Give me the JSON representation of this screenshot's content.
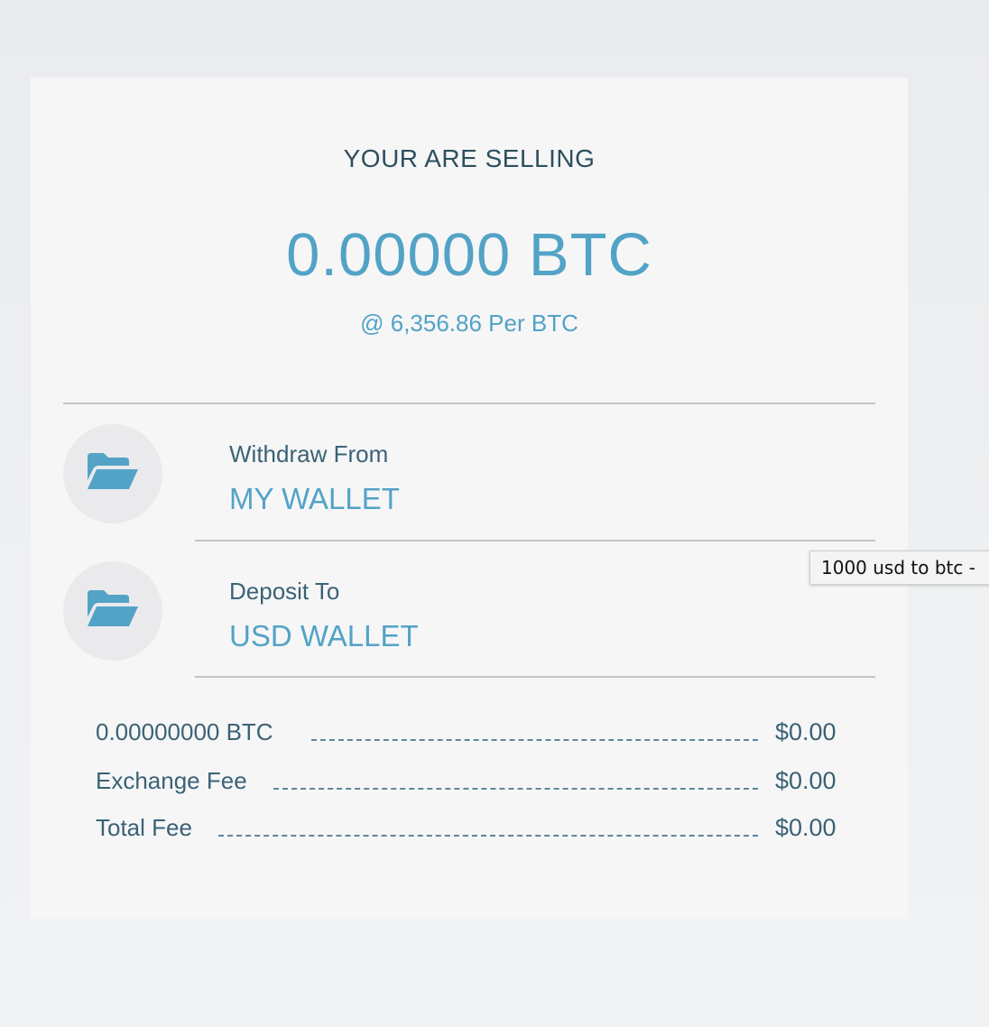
{
  "header": {
    "title": "YOUR ARE SELLING",
    "amount": "0.00000 BTC",
    "rate": "@ 6,356.86 Per BTC"
  },
  "accounts": [
    {
      "label": "Withdraw From",
      "value": "MY WALLET",
      "icon": "folder-open-icon"
    },
    {
      "label": "Deposit To",
      "value": "USD WALLET",
      "icon": "folder-open-icon"
    }
  ],
  "summary": [
    {
      "label": "0.00000000 BTC",
      "value": "$0.00"
    },
    {
      "label": "Exchange Fee",
      "value": "$0.00"
    },
    {
      "label": "Total Fee",
      "value": "$0.00"
    }
  ],
  "tooltip": {
    "text": "1000 usd to btc -"
  },
  "colors": {
    "accent": "#52a3c6",
    "text_dark": "#2d4f5e",
    "text_muted": "#3b6275",
    "card_bg": "#f6f6f7",
    "page_bg": "#eceef0"
  }
}
